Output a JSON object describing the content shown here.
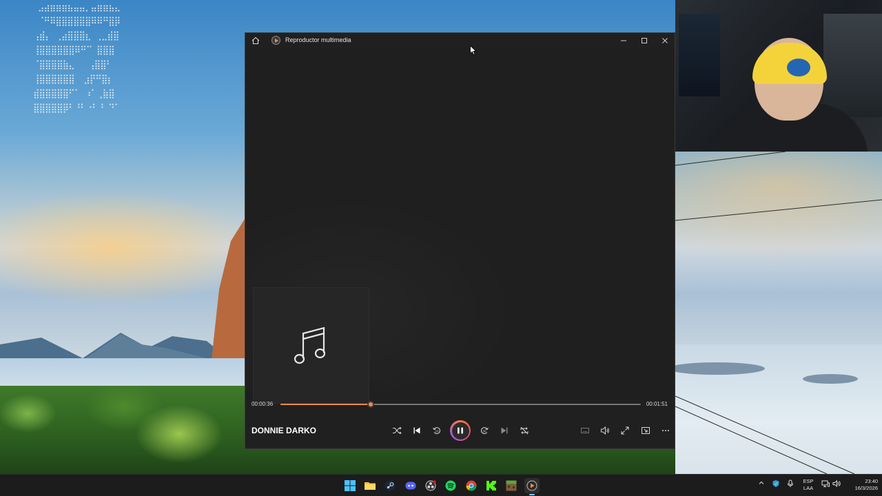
{
  "desktop": {
    "braille_art_lines": [
      " ⣠⣴⣶⣶⣶⣦⣤⣤⡀⣤⣶⣶⣦⣄",
      " ⠈⠛⠿⣿⣿⣿⣿⣿⣿⠿⠿⠛⣿⡿",
      "⢠⣾⡄ ⢀⣴⣿⣿⣿⣆ ⢀⣀⣾⣿",
      "⢸⣿⣿⣿⣿⣿⣿⠿⠛⠉ ⣿⣿⣿",
      "⠈⣿⣿⣿⣿⣷⣄   ⢠⣿⣿⠃",
      "⢸⣿⣿⣿⣿⣿⣿  ⣰⡟⠛⣿⡆",
      "⣾⣿⣿⣿⣿⣿⠋⠁ ⠰⠁⢀⣷⣿",
      "⣿⣿⣿⣿⣿⡿⠃⠘⠃⠐⠃⠘ ⠙⠁"
    ]
  },
  "player": {
    "window_title": "Reproductor multimedia",
    "song_title": "DONNIE DARKO",
    "time_elapsed": "00:00:36",
    "time_total": "00:01:51",
    "progress_fraction": 0.25,
    "accent_color": "#ff8a4c",
    "icons": {
      "home": "home-icon",
      "app": "media-player-icon",
      "minimize": "minimize-icon",
      "maximize": "maximize-icon",
      "close": "close-icon",
      "album_placeholder": "music-note-icon",
      "shuffle": "shuffle-icon",
      "previous": "previous-icon",
      "rewind": "rewind-10-icon",
      "pause": "pause-icon",
      "forward": "forward-30-icon",
      "next": "next-icon",
      "repeat": "repeat-off-icon",
      "captions": "captions-icon",
      "volume": "volume-icon",
      "fullscreen": "fullscreen-icon",
      "miniplayer": "miniplayer-icon",
      "more": "more-icon"
    }
  },
  "taskbar": {
    "apps": [
      "start",
      "file-explorer",
      "steam",
      "discord",
      "obs",
      "spotify",
      "chrome",
      "kick",
      "minecraft",
      "media-player"
    ],
    "active_app": "media-player",
    "lang_line1": "ESP",
    "lang_line2": "LAA",
    "time": "23:40",
    "date": "16/3/2026"
  }
}
